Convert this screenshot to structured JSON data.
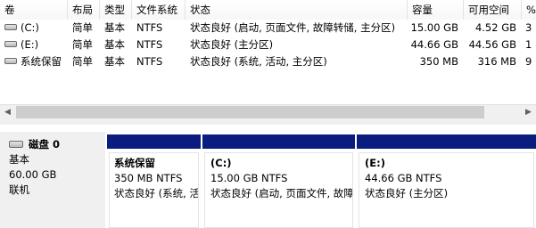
{
  "columns": [
    {
      "key": "volume",
      "label": "卷"
    },
    {
      "key": "layout",
      "label": "布局"
    },
    {
      "key": "type",
      "label": "类型"
    },
    {
      "key": "fs",
      "label": "文件系统"
    },
    {
      "key": "status",
      "label": "状态"
    },
    {
      "key": "capacity",
      "label": "容量"
    },
    {
      "key": "free",
      "label": "可用空间"
    },
    {
      "key": "pct",
      "label": "%"
    }
  ],
  "volumes": [
    {
      "volume": "(C:)",
      "layout": "简单",
      "type": "基本",
      "fs": "NTFS",
      "status": "状态良好 (启动, 页面文件, 故障转储, 主分区)",
      "capacity": "15.00 GB",
      "free": "4.52 GB",
      "pct": "3"
    },
    {
      "volume": "(E:)",
      "layout": "简单",
      "type": "基本",
      "fs": "NTFS",
      "status": "状态良好 (主分区)",
      "capacity": "44.66 GB",
      "free": "44.56 GB",
      "pct": "1"
    },
    {
      "volume": "系统保留",
      "layout": "简单",
      "type": "基本",
      "fs": "NTFS",
      "status": "状态良好 (系统, 活动, 主分区)",
      "capacity": "350 MB",
      "free": "316 MB",
      "pct": "9"
    }
  ],
  "scrollbar": {
    "left_arrow": "◀",
    "right_arrow": "▶"
  },
  "disk": {
    "title": "磁盘 0",
    "type": "基本",
    "size": "60.00 GB",
    "state": "联机"
  },
  "partitions": [
    {
      "name": "系统保留",
      "size_fs": "350 MB NTFS",
      "status": "状态良好 (系统, 活动, 主分区)"
    },
    {
      "name": "(C:)",
      "size_fs": "15.00 GB NTFS",
      "status": "状态良好 (启动, 页面文件, 故障转储, 主分区)"
    },
    {
      "name": "(E:)",
      "size_fs": "44.66 GB NTFS",
      "status": "状态良好 (主分区)"
    }
  ],
  "colors": {
    "partition_bar": "#0a1d7e",
    "selection": "#cce8ff"
  }
}
